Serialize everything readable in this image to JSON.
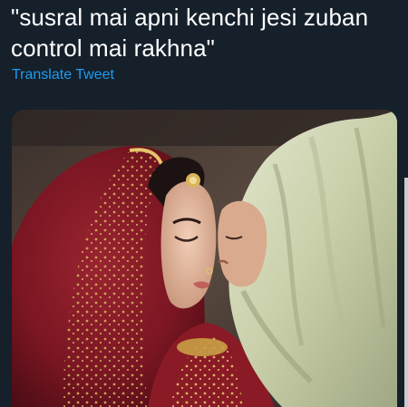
{
  "tweet": {
    "text": "\"susral mai apni kenchi jesi zuban\ncontrol mai rakhna\"",
    "translate_label": "Translate Tweet"
  },
  "media": {
    "kind": "photo"
  },
  "colors": {
    "background": "#15202b",
    "text": "#ffffff",
    "link": "#1d9bf0"
  }
}
